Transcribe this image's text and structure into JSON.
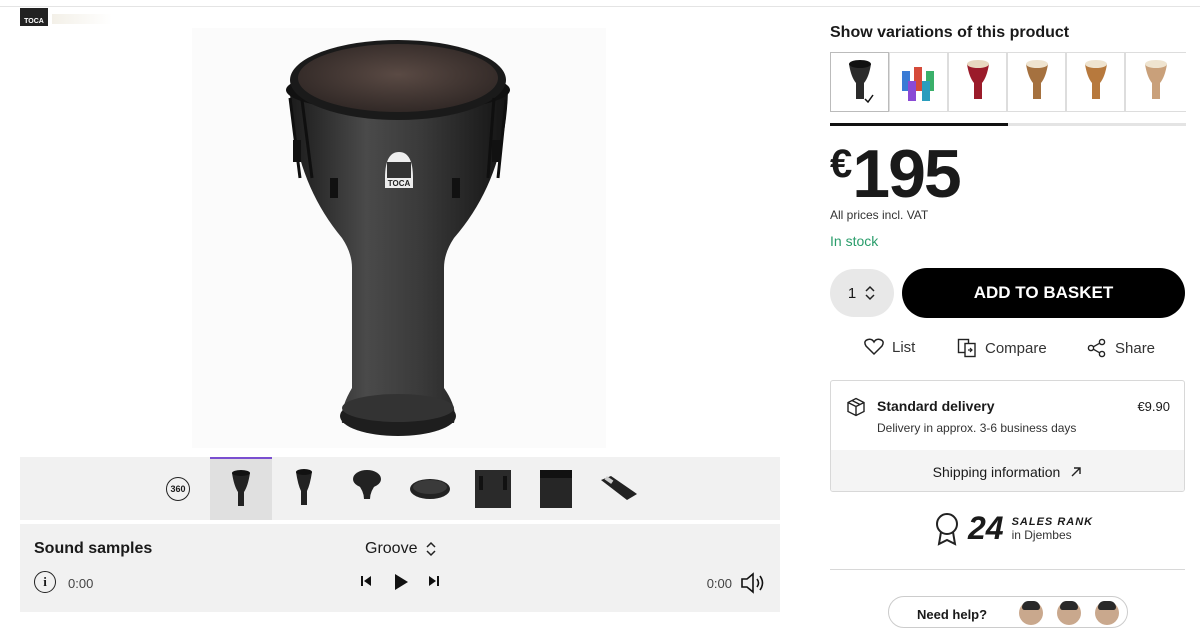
{
  "brand": {
    "logo_text": "TOCA"
  },
  "gallery": {
    "thumb_count": 7,
    "has_360": true,
    "badge_360": "360"
  },
  "sound": {
    "title": "Sound samples",
    "selected_sample": "Groove",
    "time_current": "0:00",
    "time_total": "0:00"
  },
  "variations": {
    "title": "Show variations of this product",
    "items": [
      {
        "name": "black djembe",
        "color": "#2b2b2b",
        "selected": true
      },
      {
        "name": "multi-color djembes",
        "color": "#7d8ac0",
        "selected": false
      },
      {
        "name": "red djembe",
        "color": "#9b1b2a",
        "selected": false
      },
      {
        "name": "carved djembe",
        "color": "#a5713f",
        "selected": false
      },
      {
        "name": "tan djembe",
        "color": "#b7793d",
        "selected": false
      },
      {
        "name": "light djembe",
        "color": "#c9a07a",
        "selected": false
      }
    ],
    "scroll_fraction": 0.5
  },
  "price": {
    "currency": "€",
    "amount": "195",
    "vat_note": "All prices incl. VAT",
    "stock": "In stock"
  },
  "basket": {
    "quantity": "1",
    "add_label": "ADD TO BASKET"
  },
  "actions": {
    "list": "List",
    "compare": "Compare",
    "share": "Share"
  },
  "delivery": {
    "title": "Standard delivery",
    "price": "€9.90",
    "subtitle": "Delivery in approx. 3-6 business days",
    "shipping_link": "Shipping information"
  },
  "rank": {
    "number": "24",
    "label": "SALES RANK",
    "category": "in Djembes"
  },
  "help": {
    "text": "Need help?"
  },
  "colors": {
    "accent_purple": "#7a4fd0",
    "stock_green": "#2a9d6b",
    "button_black": "#000000"
  }
}
